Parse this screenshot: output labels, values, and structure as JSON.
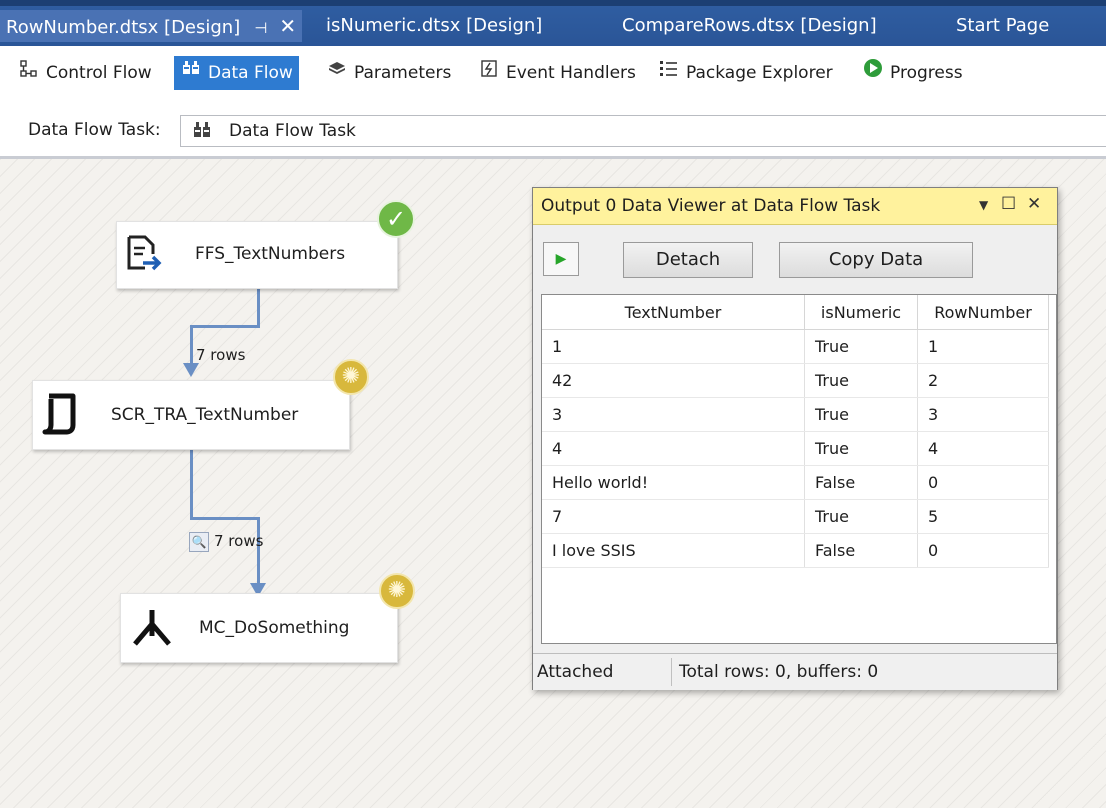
{
  "tabs": [
    {
      "label": "RowNumber.dtsx [Design]",
      "active": true
    },
    {
      "label": "isNumeric.dtsx [Design]"
    },
    {
      "label": "CompareRows.dtsx [Design]"
    },
    {
      "label": "Start Page"
    }
  ],
  "tab_pin_glyph": "⊣",
  "tab_close_glyph": "✕",
  "designer_tabs": [
    {
      "label": "Control Flow",
      "icon": "control-flow-icon"
    },
    {
      "label": "Data Flow",
      "icon": "data-flow-icon",
      "selected": true
    },
    {
      "label": "Parameters",
      "icon": "parameters-icon"
    },
    {
      "label": "Event Handlers",
      "icon": "event-handlers-icon"
    },
    {
      "label": "Package Explorer",
      "icon": "package-explorer-icon"
    },
    {
      "label": "Progress",
      "icon": "progress-icon"
    }
  ],
  "task": {
    "label": "Data Flow Task:",
    "value": "Data Flow Task"
  },
  "nodes": {
    "source": {
      "label": "FFS_TextNumbers",
      "status": "success"
    },
    "script": {
      "label": "SCR_TRA_TextNumber",
      "status": "running"
    },
    "multicast": {
      "label": "MC_DoSomething",
      "status": "running"
    }
  },
  "paths": {
    "first_rows": "7 rows",
    "second_rows": "7 rows"
  },
  "viewer": {
    "title": "Output 0 Data Viewer at Data Flow Task",
    "detach_label": "Detach",
    "copy_label": "Copy Data",
    "columns": [
      "TextNumber",
      "isNumeric",
      "RowNumber"
    ],
    "rows": [
      [
        "1",
        "True",
        "1"
      ],
      [
        "42",
        "True",
        "2"
      ],
      [
        "3",
        "True",
        "3"
      ],
      [
        "4",
        "True",
        "4"
      ],
      [
        "Hello world!",
        "False",
        "0"
      ],
      [
        "7",
        "True",
        "5"
      ],
      [
        "I love SSIS",
        "False",
        "0"
      ]
    ],
    "status_left": "Attached",
    "status_right": "Total rows: 0, buffers: 0"
  },
  "colors": {
    "tab_bar": "#2b579a",
    "selected_tab": "#2e7bd1",
    "viewer_title": "#fff29d",
    "success": "#6fb847",
    "running": "#d8b83c"
  }
}
